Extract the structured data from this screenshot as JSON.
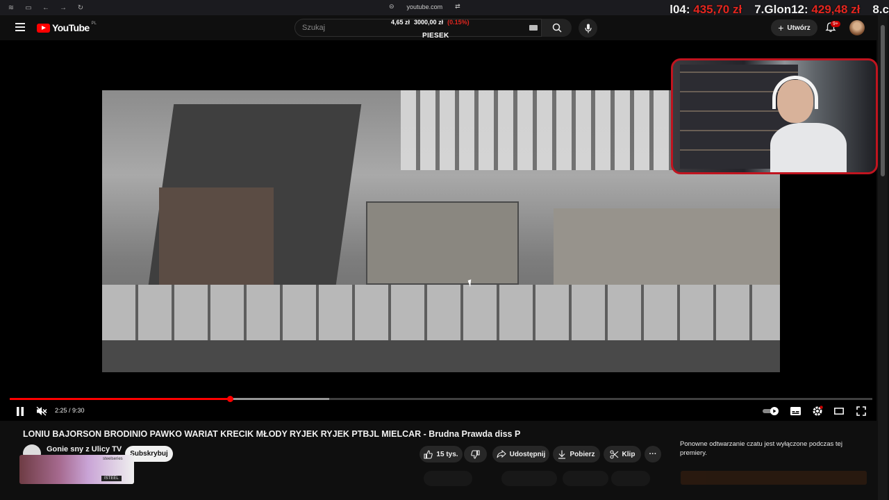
{
  "browser": {
    "url": "youtube.com"
  },
  "overlay": {
    "rank1_label": "l04:",
    "rank1_value": "435,70 zł",
    "rank2_label": "7.Glon12:",
    "rank2_value": "429,48 zł",
    "rank3_label": "8.c",
    "price_left": "4,65 zł",
    "price_right": "3000,00 zł",
    "price_change": "(0.15%)",
    "caption": "PIESEK"
  },
  "header": {
    "logo_text": "YouTube",
    "country_code": "PL",
    "search_placeholder": "Szukaj",
    "create_label": "Utwórz",
    "notif_badge": "9+"
  },
  "player": {
    "time_display": "2:25 / 9:30",
    "progress_fraction": 0.256,
    "buffered_fraction": 0.37
  },
  "video": {
    "title": "LONIU BAJORSON BRODINIO PAWKO WARIAT KRECIK MŁODY RYJEK RYJEK PTBJL MIELCAR - Brudna Prawda diss P",
    "channel_name": "Gonie sny z Ulicy TV",
    "subscribe_label": "Subskrybuj",
    "likes_label": "15 tys.",
    "share_label": "Udostępnij",
    "download_label": "Pobierz",
    "clip_label": "Klip",
    "more_label": "···"
  },
  "chat": {
    "note": "Ponowne odtwarzanie czatu jest wyłączone podczas tej premiery."
  },
  "ad": {
    "brand": "steelseries",
    "tag": "ISTEEL"
  },
  "colors": {
    "accent_red": "#ff0000",
    "overlay_red": "#e3261f",
    "background": "#0f0f0f"
  }
}
